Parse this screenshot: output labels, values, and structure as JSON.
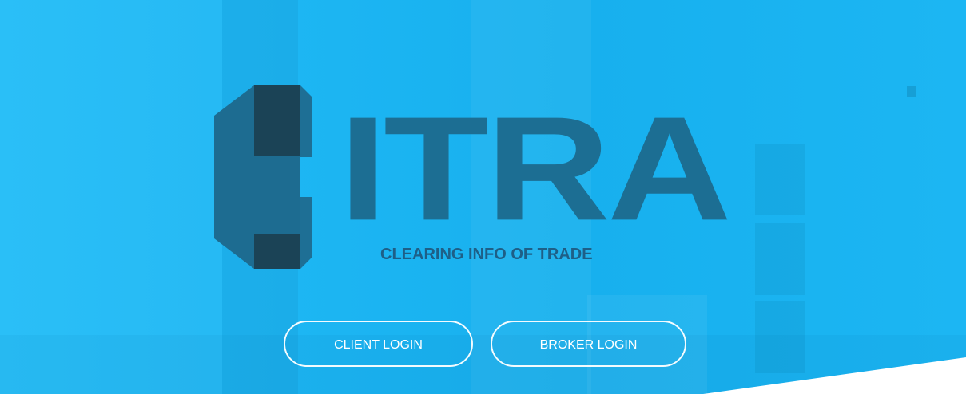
{
  "hero": {
    "logo_icon": "c-octagon-logo-icon",
    "wordmark": "ITRA",
    "tagline": "CLEARING INFO OF TRADE",
    "colors": {
      "background": "#1db6f3",
      "logo_light": "#1d6c91",
      "logo_dark": "#1b4356",
      "tagline": "#1e5f87",
      "button_border": "#ffffff"
    }
  },
  "buttons": {
    "client_login": "CLIENT LOGIN",
    "broker_login": "BROKER LOGIN"
  }
}
